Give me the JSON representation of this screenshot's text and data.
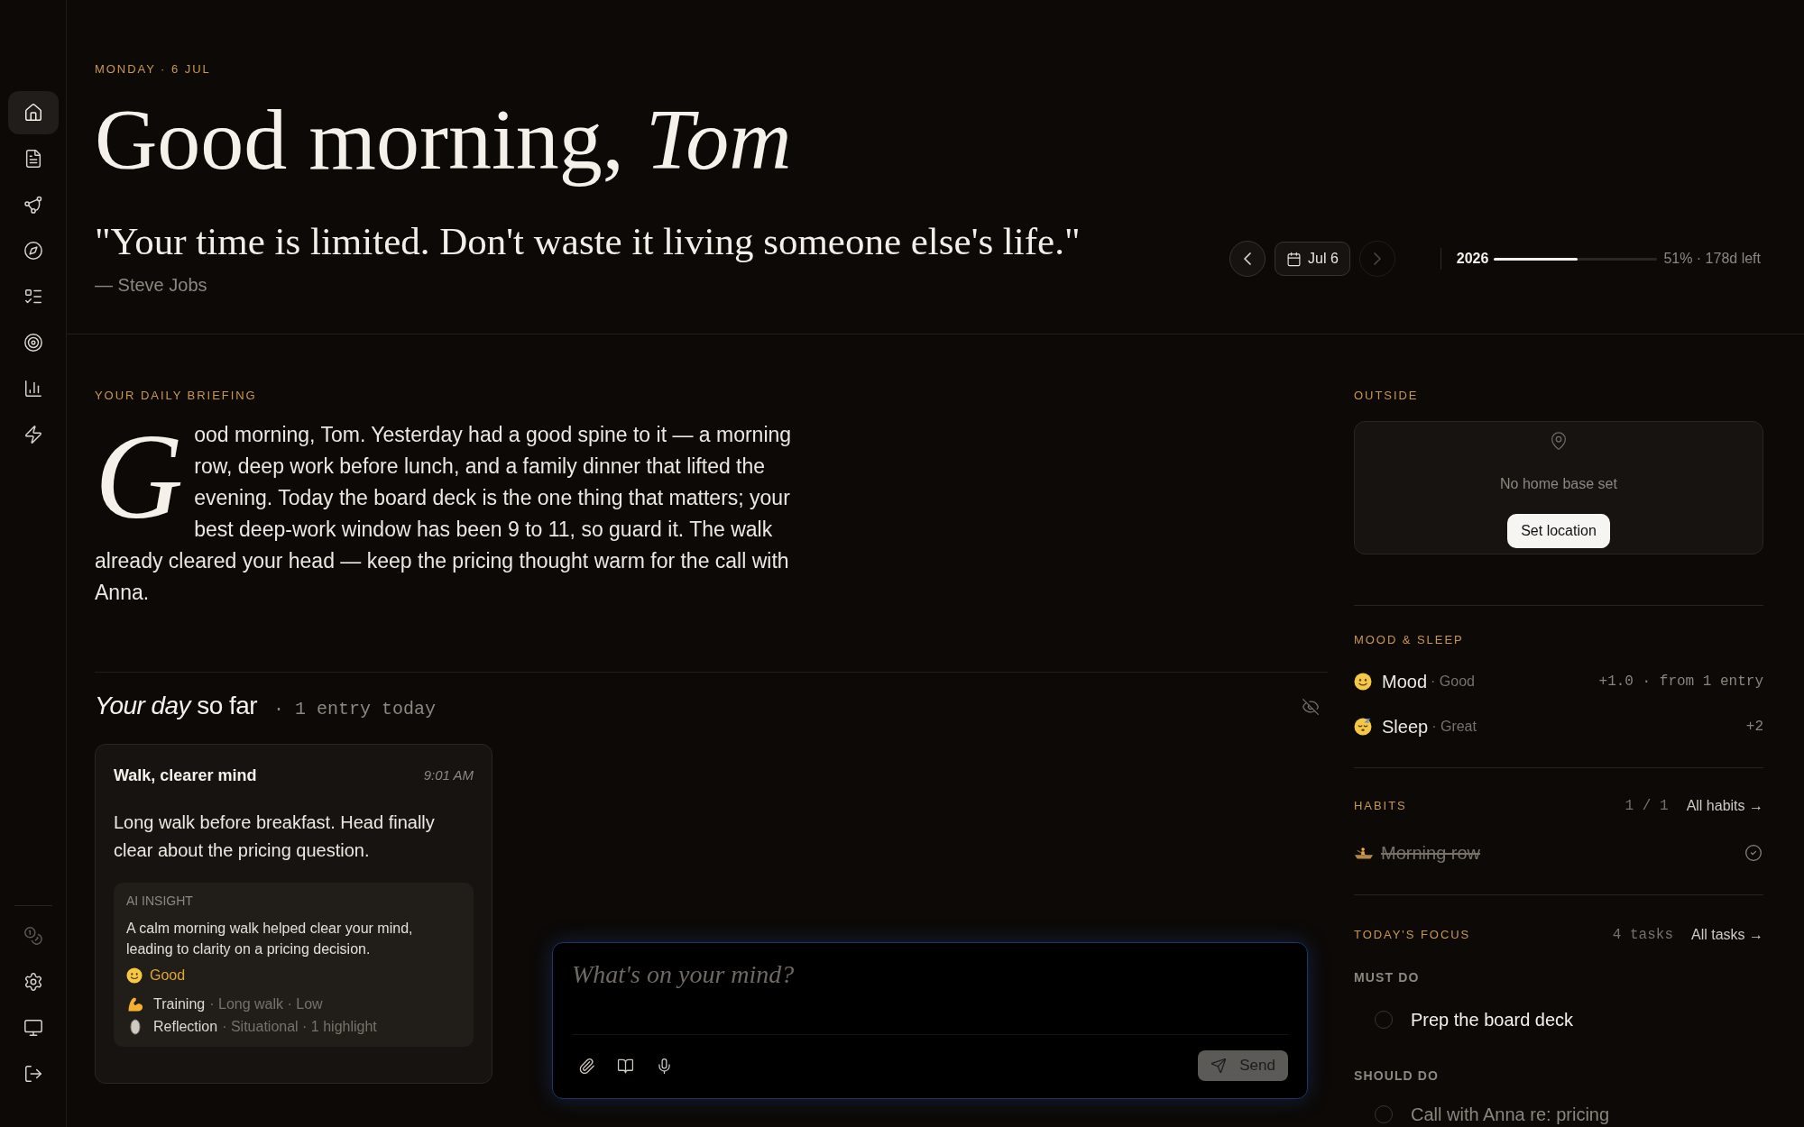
{
  "sidebar": {
    "items": [
      {
        "selected": true
      },
      {
        "selected": false
      },
      {
        "selected": false
      },
      {
        "selected": false
      },
      {
        "selected": false
      },
      {
        "selected": false
      },
      {
        "selected": false
      },
      {
        "selected": false
      }
    ]
  },
  "header": {
    "date_label": "MONDAY · 6 JUL",
    "greeting": "Good morning, *Tom*",
    "quote": "\"Your time is limited. Don't waste it living someone else's life.\"",
    "quote_author": "— Steve Jobs",
    "date_nav": {
      "previous": {
        "disabled": false
      },
      "date": "Jul 6",
      "next": {
        "disabled": true
      }
    },
    "year_progress": {
      "year": "2026",
      "level": 0.51,
      "reading": "51% · 178d left"
    }
  },
  "briefing": {
    "title": "YOUR DAILY BRIEFING",
    "drop_cap": "G",
    "text": "ood morning, Tom. Yesterday had a good spine to it — a morning row, deep work before lunch, and a family dinner that lifted the evening. Today the board deck is the one thing that matters; your best deep-work window has been 9 to 11, so guard it. The walk already cleared your head — keep the pricing thought warm for the call with Anna."
  },
  "day": {
    "title": "*Your day* so far",
    "count": "· 1 entry today",
    "entries": [
      {
        "title": "Walk, clearer mind",
        "time": "9:01 AM",
        "body": "Long walk before breakfast. Head finally clear about the pricing question.",
        "insight": {
          "label": "AI INSIGHT",
          "text": "A calm morning walk helped clear your mind, leading to clarity on a pricing decision.",
          "mood": "Good",
          "tags": [
            {
              "kind": "training",
              "name": "Training",
              "detail": "· Long walk · Low"
            },
            {
              "kind": "reflection",
              "name": "Reflection",
              "detail": "· Situational · 1 highlight"
            }
          ]
        }
      }
    ]
  },
  "composer": {
    "placeholder": "What's on your mind?",
    "send_label": "Send"
  },
  "outside": {
    "title": "OUTSIDE",
    "message": "No home base set",
    "button": "Set location"
  },
  "mood_sleep": {
    "title": "MOOD & SLEEP",
    "rows": [
      {
        "kind": "mood",
        "label": "Mood",
        "value": "· Good",
        "stat": "+1.0 · from 1 entry"
      },
      {
        "kind": "sleep",
        "label": "Sleep",
        "value": "· Great",
        "stat": "+2"
      }
    ]
  },
  "habits": {
    "title": "HABITS",
    "count": "1 / 1",
    "link": "All habits →",
    "items": [
      {
        "name": "Morning row",
        "done": true
      }
    ]
  },
  "focus": {
    "title": "TODAY'S FOCUS",
    "count": "4 tasks",
    "link": "All tasks →",
    "groups": [
      {
        "label": "MUST DO",
        "tasks": [
          {
            "text": "Prep the board deck",
            "done": false,
            "muted": false
          }
        ]
      },
      {
        "label": "SHOULD DO",
        "tasks": [
          {
            "text": "Call with Anna re: pricing",
            "done": false,
            "muted": true
          }
        ]
      }
    ]
  }
}
